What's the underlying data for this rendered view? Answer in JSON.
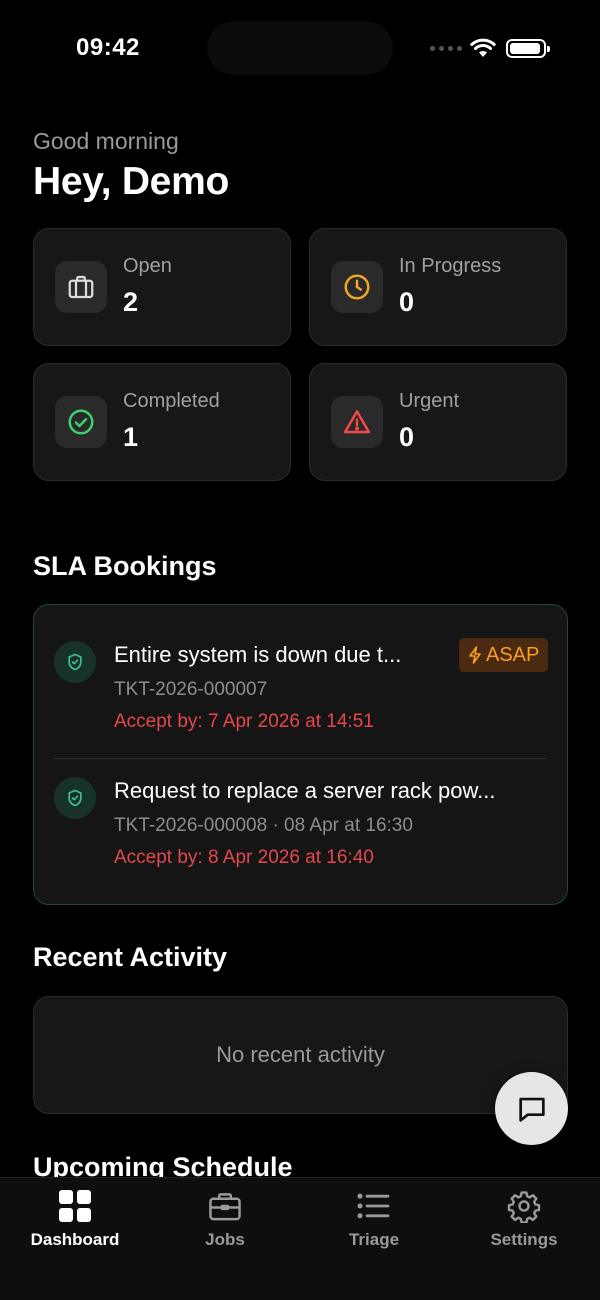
{
  "status_bar": {
    "time": "09:42"
  },
  "header": {
    "greeting": "Good morning",
    "title": "Hey, Demo"
  },
  "stats": [
    {
      "label": "Open",
      "value": "2",
      "icon": "briefcase-icon",
      "icon_color": "#dcdcdc"
    },
    {
      "label": "In Progress",
      "value": "0",
      "icon": "clock-icon",
      "icon_color": "#f5a524"
    },
    {
      "label": "Completed",
      "value": "1",
      "icon": "check-circle-icon",
      "icon_color": "#3ecf6f"
    },
    {
      "label": "Urgent",
      "value": "0",
      "icon": "alert-triangle-icon",
      "icon_color": "#ef4b4b"
    }
  ],
  "sla": {
    "section_title": "SLA Bookings",
    "border_color": "#1e4a3a",
    "items": [
      {
        "title": "Entire system is down due t...",
        "meta": "TKT-2026-000007",
        "accept_by": "Accept by: 7 Apr 2026 at 14:51",
        "badge": "ASAP"
      },
      {
        "title": "Request to replace a server rack pow...",
        "meta": "TKT-2026-000008 · 08 Apr at 16:30",
        "accept_by": "Accept by: 8 Apr 2026 at 16:40"
      }
    ]
  },
  "recent_activity": {
    "section_title": "Recent Activity",
    "empty_text": "No recent activity"
  },
  "upcoming": {
    "section_title": "Upcoming Schedule"
  },
  "fab": {
    "icon": "chat-icon"
  },
  "tab_bar": {
    "tabs": [
      {
        "label": "Dashboard",
        "icon": "grid-icon",
        "active": true
      },
      {
        "label": "Jobs",
        "icon": "briefcase-icon",
        "active": false
      },
      {
        "label": "Triage",
        "icon": "list-icon",
        "active": false
      },
      {
        "label": "Settings",
        "icon": "gear-icon",
        "active": false
      }
    ]
  }
}
